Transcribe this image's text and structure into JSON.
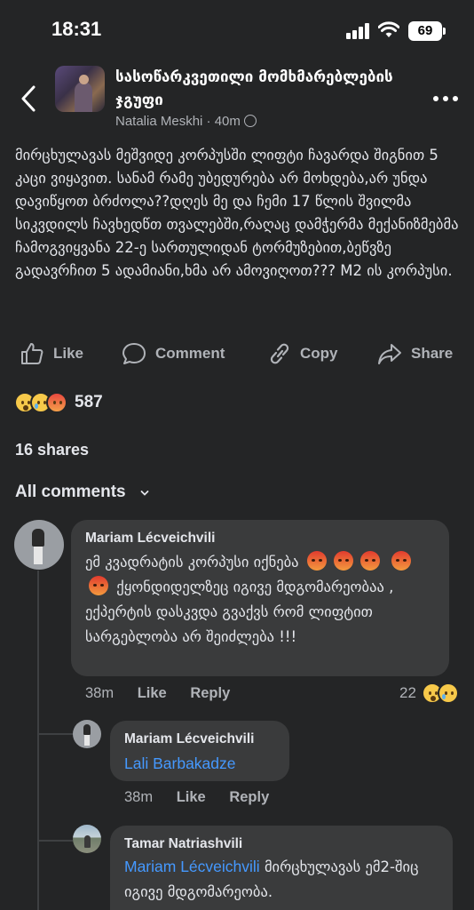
{
  "status": {
    "time": "18:31",
    "battery": "69"
  },
  "header": {
    "group_name": "სასოწარკვეთილი მომხმარებლების ჯგუფი",
    "author": "Natalia Meskhi",
    "time": "40m",
    "separator": "·"
  },
  "post": {
    "text": "მირცხულავას მეშვიდე კორპუსში ლიფტი ჩავარდა შიგნით 5 კაცი ვიყავით. სანამ რამე უბედურება არ მოხდება,არ უნდა დავიწყოთ ბრძოლა??დღეს მე და ჩემი 17 წლის შვილმა სიკვდილს ჩავხედწთ თვალებში,რაღაც დამჭერმა მექანიზმებმა ჩამოგვიყვანა 22-ე სართულიდან ტორმუზებით,ბეწვზე გადავრჩით 5 ადამიანი,ხმა არ ამოვიღოთ??? M2 ის კორპუსი."
  },
  "actions": {
    "like": "Like",
    "comment": "Comment",
    "copy": "Copy",
    "share": "Share"
  },
  "reactions": {
    "count": "587"
  },
  "shares": "16 shares",
  "sort_label": "All comments",
  "comments": [
    {
      "author": "Mariam Lécveichvili",
      "text_a": "ემ კვადრატის კორპუსი იქნება",
      "text_b": "ქყონდიდელზეც იგივე მდგომარეობაა , ექპერტის დასკვდა გვაქვს რომ ლიფტით სარგებლობა არ შეიძლება !!!",
      "time": "38m",
      "like": "Like",
      "reply": "Reply",
      "reactions": "22"
    },
    {
      "author": "Mariam Lécveichvili",
      "mention": "Lali Barbakadze",
      "time": "38m",
      "like": "Like",
      "reply": "Reply"
    },
    {
      "author": "Tamar Natriashvili",
      "mention": "Mariam Lécveichvili",
      "text": "მირცხულავას ემ2-შიც იგივე მდგომარეობა."
    }
  ]
}
